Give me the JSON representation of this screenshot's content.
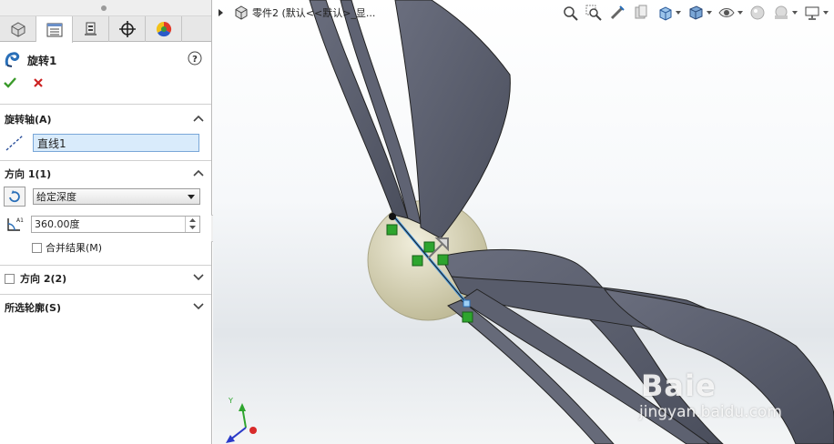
{
  "property_manager": {
    "feature_title": "旋转1",
    "sections": {
      "axis": {
        "title": "旋转轴(A)",
        "value": "直线1"
      },
      "direction1": {
        "title": "方向 1(1)",
        "end_condition": "给定深度",
        "angle": "360.00度",
        "merge_label": "合并结果(M)"
      },
      "direction2": {
        "title": "方向 2(2)"
      },
      "contours": {
        "title": "所选轮廓(S)"
      }
    }
  },
  "viewport": {
    "tree_path": "零件2  (默认<<默认>_显...",
    "watermark_main": "Baie",
    "watermark_sub": "jingyan.baidu.com",
    "triad_label": "Y"
  },
  "colors": {
    "accept": "#3a9a2a",
    "cancel": "#cc2222",
    "model": "#5a5e6e",
    "highlight": "#4a9ae0"
  }
}
